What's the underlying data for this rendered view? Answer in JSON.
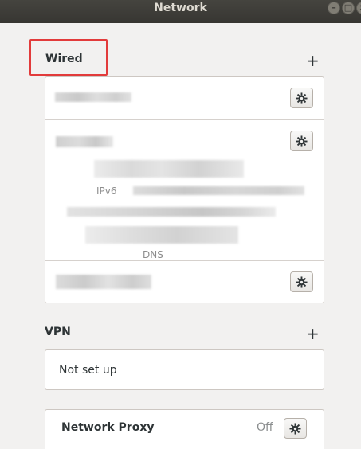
{
  "window": {
    "title": "Network"
  },
  "wired": {
    "section_title": "Wired",
    "add_symbol": "+",
    "details_labels": {
      "ipv6": "IPv6",
      "dns": "DNS"
    }
  },
  "vpn": {
    "section_title": "VPN",
    "add_symbol": "+",
    "empty_text": "Not set up"
  },
  "proxy": {
    "label": "Network Proxy",
    "status": "Off"
  },
  "colors": {
    "highlight": "#e23b3b",
    "titlebar": "#3c3b37",
    "window_bg": "#f2f1f0"
  }
}
